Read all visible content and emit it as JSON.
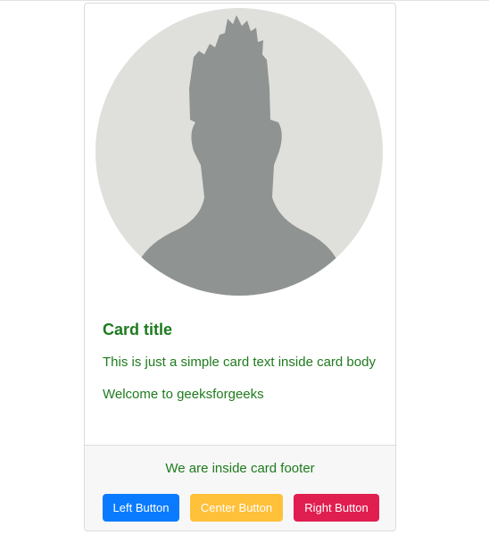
{
  "card": {
    "image_alt": "avatar-placeholder",
    "title": "Card title",
    "text": "This is just a simple card text inside card body",
    "text_2": "Welcome to geeksforgeeks"
  },
  "footer": {
    "text": "We are inside card footer",
    "buttons": [
      {
        "label": "Left Button",
        "color": "#0a7bff"
      },
      {
        "label": "Center Button",
        "color": "#ffc03a"
      },
      {
        "label": "Right Button",
        "color": "#e01e50"
      }
    ]
  },
  "colors": {
    "text": "#1e7b1e",
    "avatar_bg": "#dfe0dc",
    "avatar_silhouette": "#8f9391"
  }
}
